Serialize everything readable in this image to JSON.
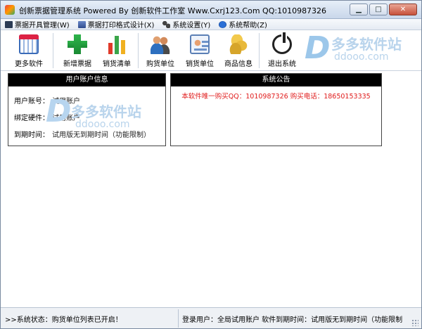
{
  "window": {
    "title": "创新票据管理系统 Powered By 创新软件工作室 Www.Cxrj123.Com QQ:1010987326",
    "controls": {
      "minimize": "▁",
      "maximize": "□",
      "close": "✕"
    }
  },
  "menu": [
    {
      "label": "票据开具管理(W)",
      "icon": "ticket-icon"
    },
    {
      "label": "票据打印格式设计(X)",
      "icon": "printer-icon"
    },
    {
      "label": "系统设置(Y)",
      "icon": "settings-icon"
    },
    {
      "label": "系统帮助(Z)",
      "icon": "help-icon"
    }
  ],
  "toolbar": [
    {
      "label": "更多软件",
      "icon": "calendar-icon"
    },
    {
      "label": "新增票据",
      "icon": "plus-icon"
    },
    {
      "label": "销货清单",
      "icon": "bar-chart-icon"
    },
    {
      "label": "购货单位",
      "icon": "users-icon"
    },
    {
      "label": "销货单位",
      "icon": "id-card-icon"
    },
    {
      "label": "商品信息",
      "icon": "coins-icon"
    },
    {
      "label": "退出系统",
      "icon": "power-icon"
    }
  ],
  "watermark": {
    "text": "多多软件站",
    "domain": "ddooo.com",
    "letter": "D"
  },
  "account_panel": {
    "title": "用户账户信息",
    "rows": [
      {
        "key": "用户账号：",
        "value": "试用账户"
      },
      {
        "key": "绑定硬件：",
        "value": "试用账户"
      },
      {
        "key": "到期时间：",
        "value": "试用版无到期时间（功能限制）"
      }
    ]
  },
  "notice_panel": {
    "title": "系统公告",
    "text": "本软件唯一购买QQ：1010987326 购买电话：18650153335",
    "color": "#e01b1b"
  },
  "status": {
    "left": ">>系统状态：购货单位列表已开启！",
    "right": "登录用户：全局试用账户 软件到期时间：试用版无到期时间（功能限制"
  }
}
